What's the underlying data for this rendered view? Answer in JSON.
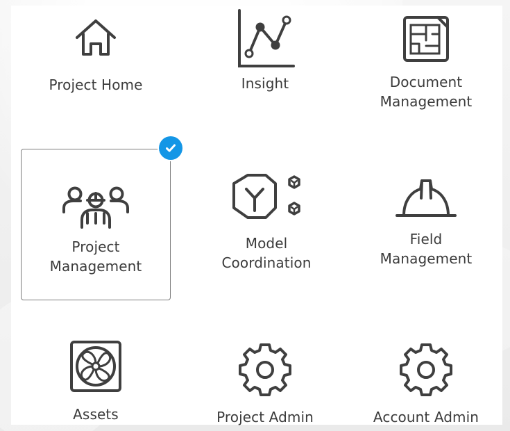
{
  "tiles": [
    {
      "label_lines": [
        "Project Home"
      ],
      "icon": "house-icon"
    },
    {
      "label_lines": [
        "Insight"
      ],
      "icon": "line-chart-icon"
    },
    {
      "label_lines": [
        "Document",
        "Management"
      ],
      "icon": "floor-plan-icon"
    },
    {
      "label_lines": [
        "Project",
        "Management"
      ],
      "icon": "team-icon",
      "selected": true
    },
    {
      "label_lines": [
        "Model",
        "Coordination"
      ],
      "icon": "model-cubes-icon"
    },
    {
      "label_lines": [
        "Field",
        "Management"
      ],
      "icon": "hard-hat-icon"
    },
    {
      "label_lines": [
        "Assets"
      ],
      "icon": "fan-icon"
    },
    {
      "label_lines": [
        "Project Admin"
      ],
      "icon": "gear-icon"
    },
    {
      "label_lines": [
        "Account Admin"
      ],
      "icon": "gear-icon"
    }
  ],
  "colors": {
    "icon_stroke": "#3f3f3f",
    "selected_badge": "#1496e6",
    "selected_border": "#7b7b7b",
    "text": "#3b3b3b"
  }
}
